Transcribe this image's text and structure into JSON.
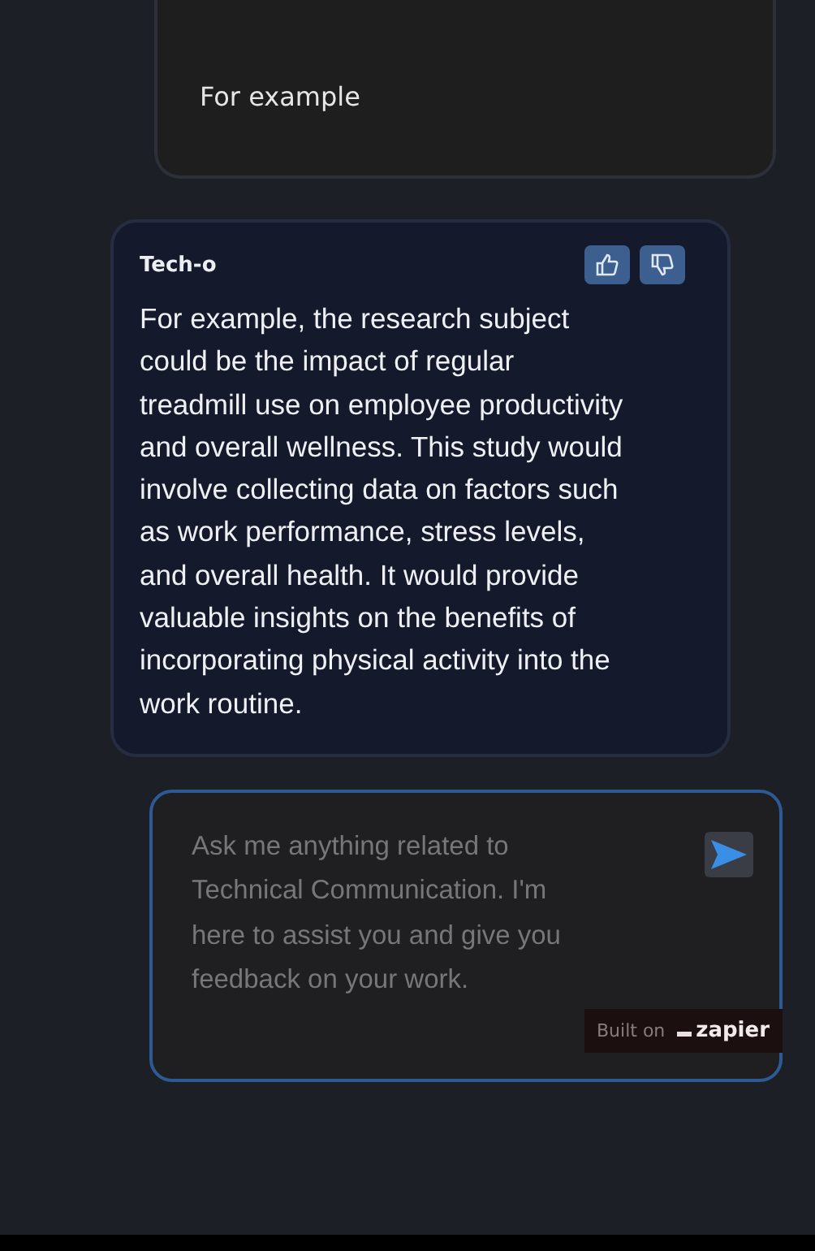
{
  "user_message": {
    "text": "For example"
  },
  "bot_message": {
    "sender": "Tech-o",
    "text": "For example, the research subject could be the impact of regular treadmill use on employee productivity and overall wellness. This study would involve collecting data on factors such as work performance, stress levels, and overall health. It would provide valuable insights on the benefits of incorporating physical activity into the work routine.",
    "feedback": [
      {
        "kind": "thumbs_up"
      },
      {
        "kind": "thumbs_down"
      }
    ]
  },
  "composer": {
    "placeholder": "Ask me anything related to Technical Communication. I'm here to assist you and give you feedback on your work."
  },
  "badge": {
    "prefix": "Built on",
    "brand": "zapier"
  }
}
